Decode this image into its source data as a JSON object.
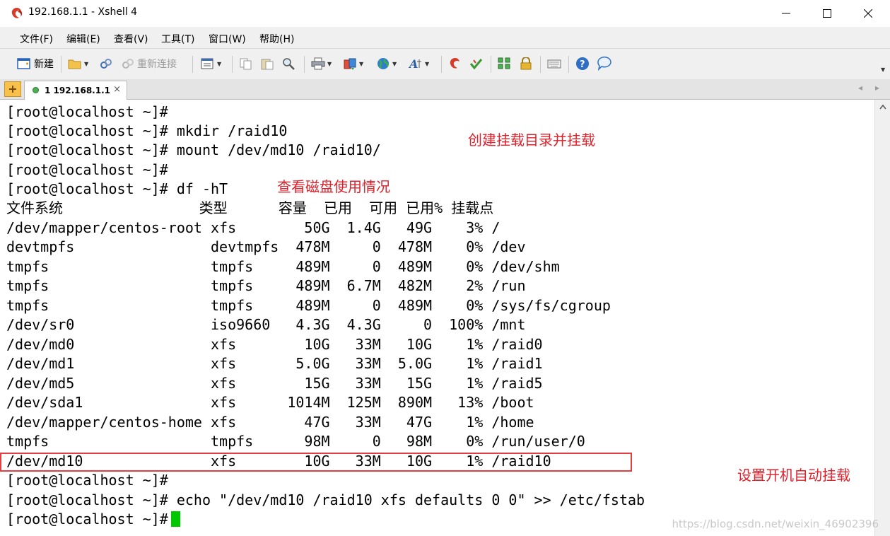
{
  "window": {
    "title": "192.168.1.1 - Xshell 4",
    "controls": {
      "minimize": "—",
      "maximize": "☐",
      "close": "✕"
    }
  },
  "menu": [
    {
      "label": "文件(F)"
    },
    {
      "label": "编辑(E)"
    },
    {
      "label": "查看(V)"
    },
    {
      "label": "工具(T)"
    },
    {
      "label": "窗口(W)"
    },
    {
      "label": "帮助(H)"
    }
  ],
  "toolbar": {
    "new_label": "新建",
    "reconnect_label": "重新连接"
  },
  "tab": {
    "label": "1 192.168.1.1",
    "close": "×",
    "nav_prev": "◂",
    "nav_next": "▸"
  },
  "terminal": {
    "lines": [
      "[root@localhost ~]#",
      "[root@localhost ~]# mkdir /raid10",
      "[root@localhost ~]# mount /dev/md10 /raid10/",
      "[root@localhost ~]#",
      "[root@localhost ~]# df -hT",
      "文件系统                类型      容量  已用  可用 已用% 挂载点",
      "/dev/mapper/centos-root xfs        50G  1.4G   49G    3% /",
      "devtmpfs                devtmpfs  478M     0  478M    0% /dev",
      "tmpfs                   tmpfs     489M     0  489M    0% /dev/shm",
      "tmpfs                   tmpfs     489M  6.7M  482M    2% /run",
      "tmpfs                   tmpfs     489M     0  489M    0% /sys/fs/cgroup",
      "/dev/sr0                iso9660   4.3G  4.3G     0  100% /mnt",
      "/dev/md0                xfs        10G   33M   10G    1% /raid0",
      "/dev/md1                xfs       5.0G   33M  5.0G    1% /raid1",
      "/dev/md5                xfs        15G   33M   15G    1% /raid5",
      "/dev/sda1               xfs      1014M  125M  890M   13% /boot",
      "/dev/mapper/centos-home xfs        47G   33M   47G    1% /home",
      "tmpfs                   tmpfs      98M     0   98M    0% /run/user/0",
      "/dev/md10               xfs        10G   33M   10G    1% /raid10",
      "[root@localhost ~]#",
      "[root@localhost ~]# echo \"/dev/md10 /raid10 xfs defaults 0 0\" >> /etc/fstab",
      "[root@localhost ~]#"
    ]
  },
  "annotations": {
    "mount_note": "创建挂载目录并挂载",
    "df_note": "查看磁盘使用情况",
    "fstab_note": "设置开机自动挂载"
  },
  "watermark": "https://blog.csdn.net/weixin_46902396",
  "colors": {
    "annotation": "#e0202a",
    "cursor": "#00c800",
    "highlight_box": "#e24040"
  }
}
